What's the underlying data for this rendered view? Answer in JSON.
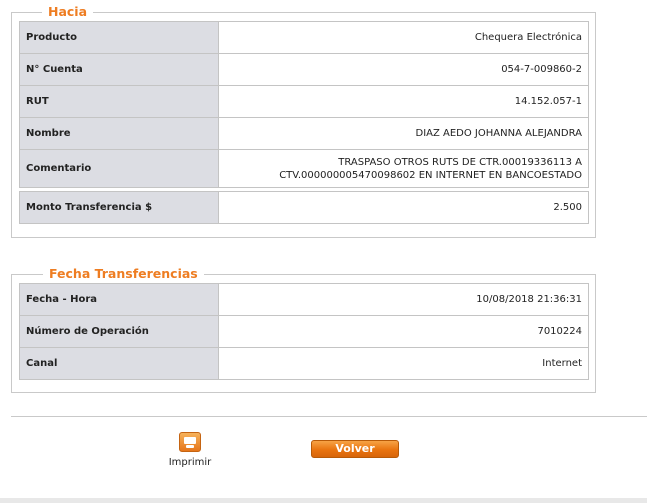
{
  "hacia": {
    "legend": "Hacia",
    "rows": [
      {
        "label": "Producto",
        "value": "Chequera Electrónica"
      },
      {
        "label": "N° Cuenta",
        "value": "054-7-009860-2"
      },
      {
        "label": "RUT",
        "value": "14.152.057-1"
      },
      {
        "label": "Nombre",
        "value": "DIAZ AEDO JOHANNA ALEJANDRA"
      },
      {
        "label": "Comentario",
        "value_line1": "TRASPASO OTROS RUTS DE CTR.00019336113 A",
        "value_line2": "CTV.00000000547009860​2 EN INTERNET EN BANCOESTADO"
      }
    ],
    "monto": {
      "label": "Monto Transferencia $",
      "value": "2.500"
    }
  },
  "fecha": {
    "legend": "Fecha Transferencias",
    "rows": [
      {
        "label": "Fecha - Hora",
        "value": "10/08/2018 21:36:31"
      },
      {
        "label": "Número de Operación",
        "value": "7010224"
      },
      {
        "label": "Canal",
        "value": "Internet"
      }
    ]
  },
  "actions": {
    "print_label": "Imprimir",
    "print_icon": "printer-icon",
    "volver_label": "Volver"
  },
  "colors": {
    "accent": "#ee7d22",
    "label_bg": "#dcdde3",
    "border": "#c4c4c4"
  }
}
